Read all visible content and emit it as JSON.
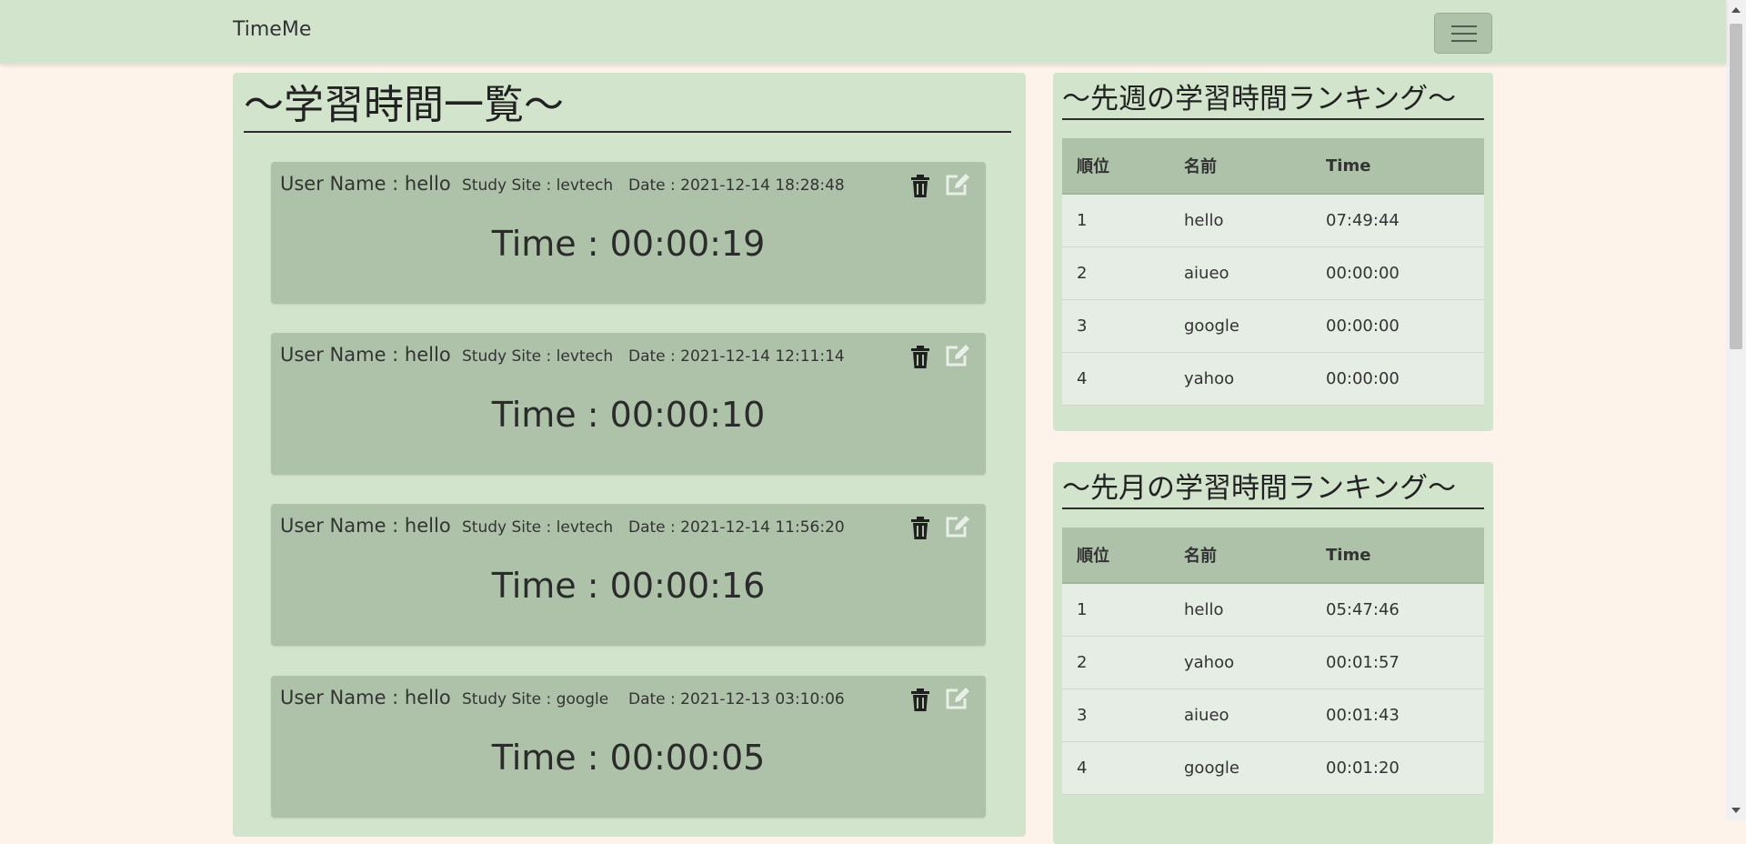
{
  "navbar": {
    "brand": "TimeMe"
  },
  "main": {
    "title": "～学習時間一覧～",
    "records": [
      {
        "user": "User Name : hello",
        "site": "Study Site : levtech",
        "date": "Date : 2021-12-14 18:28:48",
        "time": "Time : 00:00:19"
      },
      {
        "user": "User Name : hello",
        "site": "Study Site : levtech",
        "date": "Date : 2021-12-14 12:11:14",
        "time": "Time : 00:00:10"
      },
      {
        "user": "User Name : hello",
        "site": "Study Site : levtech",
        "date": "Date : 2021-12-14 11:56:20",
        "time": "Time : 00:00:16"
      },
      {
        "user": "User Name : hello",
        "site": "Study Site : google",
        "date": "Date : 2021-12-13 03:10:06",
        "time": "Time : 00:00:05"
      }
    ]
  },
  "rankings": [
    {
      "title": "～先週の学習時間ランキング～",
      "headers": [
        "順位",
        "名前",
        "Time"
      ],
      "rows": [
        [
          "1",
          "hello",
          "07:49:44"
        ],
        [
          "2",
          "aiueo",
          "00:00:00"
        ],
        [
          "3",
          "google",
          "00:00:00"
        ],
        [
          "4",
          "yahoo",
          "00:00:00"
        ]
      ]
    },
    {
      "title": "～先月の学習時間ランキング～",
      "headers": [
        "順位",
        "名前",
        "Time"
      ],
      "rows": [
        [
          "1",
          "hello",
          "05:47:46"
        ],
        [
          "2",
          "yahoo",
          "00:01:57"
        ],
        [
          "3",
          "aiueo",
          "00:01:43"
        ],
        [
          "4",
          "google",
          "00:01:20"
        ]
      ]
    }
  ],
  "icons": {
    "delete": "trash-icon",
    "edit": "edit-icon"
  },
  "colors": {
    "page_bg": "#fdf3ea",
    "panel_bg": "#d3e4cd",
    "card_bg": "#adc2a9",
    "row_bg": "#e6ede5"
  }
}
